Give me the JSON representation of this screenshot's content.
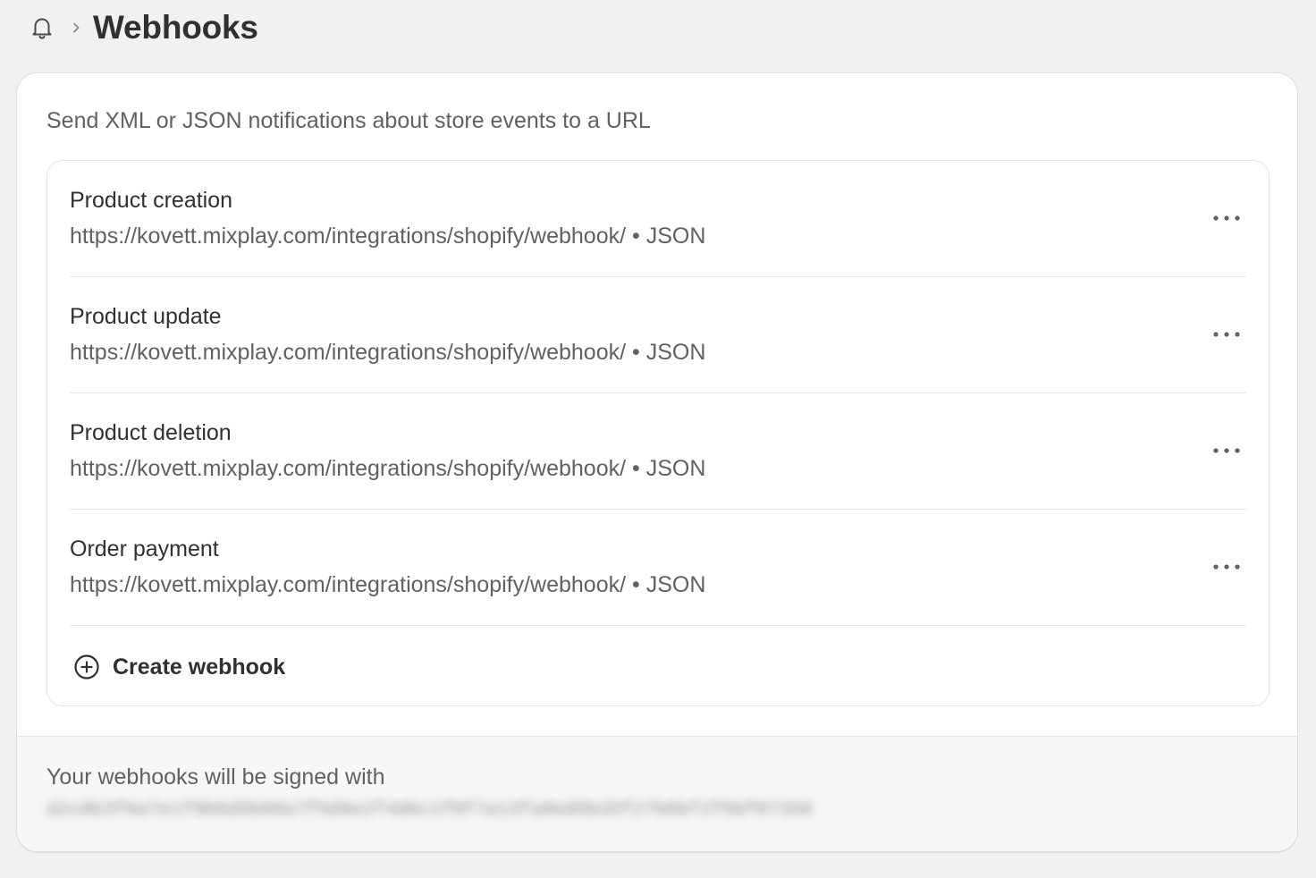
{
  "header": {
    "breadcrumb_icon": "bell-icon",
    "separator_icon": "chevron-right-icon",
    "title": "Webhooks"
  },
  "card": {
    "description": "Send XML or JSON notifications about store events to a URL",
    "webhooks": [
      {
        "event": "Product creation",
        "url": "https://kovett.mixplay.com/integrations/shopify/webhook/",
        "format": "JSON",
        "subtitle": "https://kovett.mixplay.com/integrations/shopify/webhook/ • JSON"
      },
      {
        "event": "Product update",
        "url": "https://kovett.mixplay.com/integrations/shopify/webhook/",
        "format": "JSON",
        "subtitle": "https://kovett.mixplay.com/integrations/shopify/webhook/ • JSON"
      },
      {
        "event": "Product deletion",
        "url": "https://kovett.mixplay.com/integrations/shopify/webhook/",
        "format": "JSON",
        "subtitle": "https://kovett.mixplay.com/integrations/shopify/webhook/ • JSON"
      },
      {
        "event": "Order payment",
        "url": "https://kovett.mixplay.com/integrations/shopify/webhook/",
        "format": "JSON",
        "subtitle": "https://kovett.mixplay.com/integrations/shopify/webhook/ • JSON"
      }
    ],
    "row_menu_icon": "more-horizontal-icon",
    "create_label": "Create webhook",
    "create_icon": "plus-circle-icon"
  },
  "footer": {
    "label": "Your webhooks will be signed with",
    "secret": "d2c8b3f6a7e1f9b6d5b88a7f5d9e2f4d6c1f0f7a13fa8ed5b35f27b6bf2f6bf07356"
  },
  "colors": {
    "background": "#f1f1f1",
    "card": "#ffffff",
    "text_primary": "#303030",
    "text_secondary": "#616161",
    "divider": "#e3e3e3"
  }
}
